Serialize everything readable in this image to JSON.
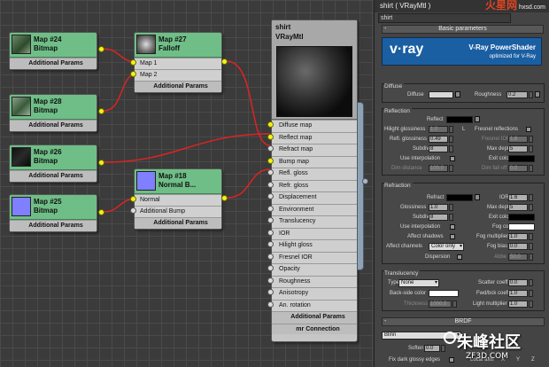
{
  "nodes": {
    "map24": {
      "name": "Map #24",
      "type": "Bitmap",
      "footer": "Additional Params"
    },
    "map28": {
      "name": "Map #28",
      "type": "Bitmap",
      "footer": "Additional Params"
    },
    "map26": {
      "name": "Map #26",
      "type": "Bitmap",
      "footer": "Additional Params"
    },
    "map25": {
      "name": "Map #25",
      "type": "Bitmap",
      "footer": "Additional Params"
    },
    "map27": {
      "name": "Map #27",
      "type": "Falloff",
      "rows": [
        "Map 1",
        "Map 2"
      ],
      "footer": "Additional Params"
    },
    "map18": {
      "name": "Map #18",
      "type": "Normal B...",
      "rows": [
        "Normal",
        "Additional Bump"
      ],
      "footer": "Additional Params"
    }
  },
  "material": {
    "name": "shirt",
    "type": "VRayMtl",
    "slots": [
      "Diffuse map",
      "Reflect map",
      "Refract map",
      "Bump map",
      "Refl. gloss",
      "Refr. gloss",
      "Displacement",
      "Environment",
      "Translucency",
      "IOR",
      "Hilight gloss",
      "Fresnel IOR",
      "Opacity",
      "Roughness",
      "Anisotropy",
      "An. rotation"
    ],
    "footers": [
      "Additional Params",
      "mr Connection"
    ]
  },
  "panel": {
    "title": "shirt  ( VRayMtl )",
    "site_logo": "火星网",
    "site_url": "hxsd.com",
    "name_field": "shirt",
    "rollout": "Basic parameters",
    "banner": {
      "logo": "v·ray",
      "product": "V-Ray PowerShader",
      "subtitle": "optimized for V-Ray"
    },
    "diffuse": {
      "group": "Diffuse",
      "diffuse_label": "Diffuse",
      "roughness_label": "Roughness",
      "roughness": "0.2"
    },
    "reflection": {
      "group": "Reflection",
      "reflect_label": "Reflect",
      "hilight_label": "Hilight glossiness",
      "hilight": "1.0",
      "lock": "L",
      "fresnel_label": "Fresnel reflections",
      "refl_gloss_label": "Refl. glossiness",
      "refl_gloss": "0.49",
      "fresnel_ior_label": "Fresnel IOR",
      "fresnel_ior": "1.6",
      "subdivs_label": "Subdivs",
      "subdivs": "8",
      "max_depth_label": "Max depth",
      "max_depth": "5",
      "use_interp_label": "Use interpolation",
      "exit_color_label": "Exit color",
      "dim_dist_label": "Dim distance",
      "dim_dist": "100.0",
      "dim_falloff_label": "Dim fall off",
      "dim_falloff": "0.0"
    },
    "refraction": {
      "group": "Refraction",
      "refract_label": "Refract",
      "ior_label": "IOR",
      "ior": "1.6",
      "glossiness_label": "Glossiness",
      "glossiness": "1.0",
      "max_depth_label": "Max depth",
      "max_depth": "5",
      "subdivs_label": "Subdivs",
      "subdivs": "8",
      "exit_color_label": "Exit color",
      "use_interp_label": "Use interpolation",
      "fog_color_label": "Fog color",
      "affect_shadows_label": "Affect shadows",
      "fog_mult_label": "Fog multiplier",
      "fog_mult": "1.0",
      "affect_channels_label": "Affect channels",
      "affect_channels": "Color only",
      "fog_bias_label": "Fog bias",
      "fog_bias": "0.0",
      "dispersion_label": "Dispersion",
      "abbe_label": "Abbe",
      "abbe": "50.0"
    },
    "translucency": {
      "group": "Translucency",
      "type_label": "Type",
      "type": "None",
      "scatter_label": "Scatter coeff",
      "scatter": "0.0",
      "back_color_label": "Back-side color",
      "fwd_bck_label": "Fwd/bck coeff",
      "fwd_bck": "1.0",
      "thickness_label": "Thickness",
      "thickness": "1000.0",
      "light_mult_label": "Light multiplier",
      "light_mult": "1.0"
    },
    "brdf": {
      "rollout": "BRDF",
      "type": "Blinn",
      "soften_label": "Soften",
      "soften": "0.0",
      "fix_label": "Fix dark glossy edges",
      "local_axis_label": "Local axis",
      "axes": [
        "X",
        "Y",
        "Z"
      ]
    }
  },
  "watermark": {
    "text": "朱峰社区",
    "url": "ZF3D.COM"
  },
  "colors": {
    "node_green": "#6fbe87",
    "wire": "#e02222",
    "port": "#f2f21a",
    "banner": "#1b5fa3"
  }
}
